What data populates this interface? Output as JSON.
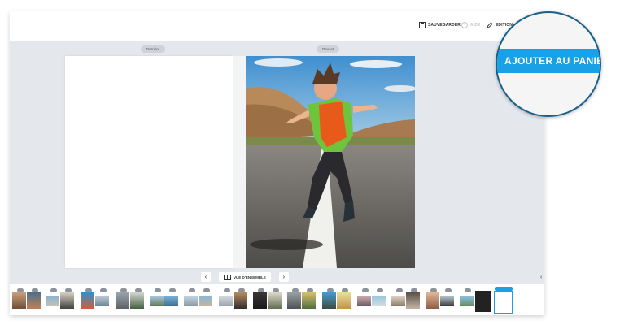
{
  "toolbar": {
    "save_label": "SAUVEGARDER",
    "help_label": "AIDE",
    "edition_label": "EDITION"
  },
  "pages": {
    "left_label": "Derrière",
    "right_label": "Devant"
  },
  "navigation": {
    "overview_label": "VUE D'ENSEMBLE",
    "prev_icon": "chevron-left-icon",
    "next_icon": "chevron-right-icon"
  },
  "magnifier": {
    "cta_label": "AJOUTER AU PANIER"
  },
  "colors": {
    "accent": "#1aa0e6",
    "workspace": "#e4e7ec"
  }
}
